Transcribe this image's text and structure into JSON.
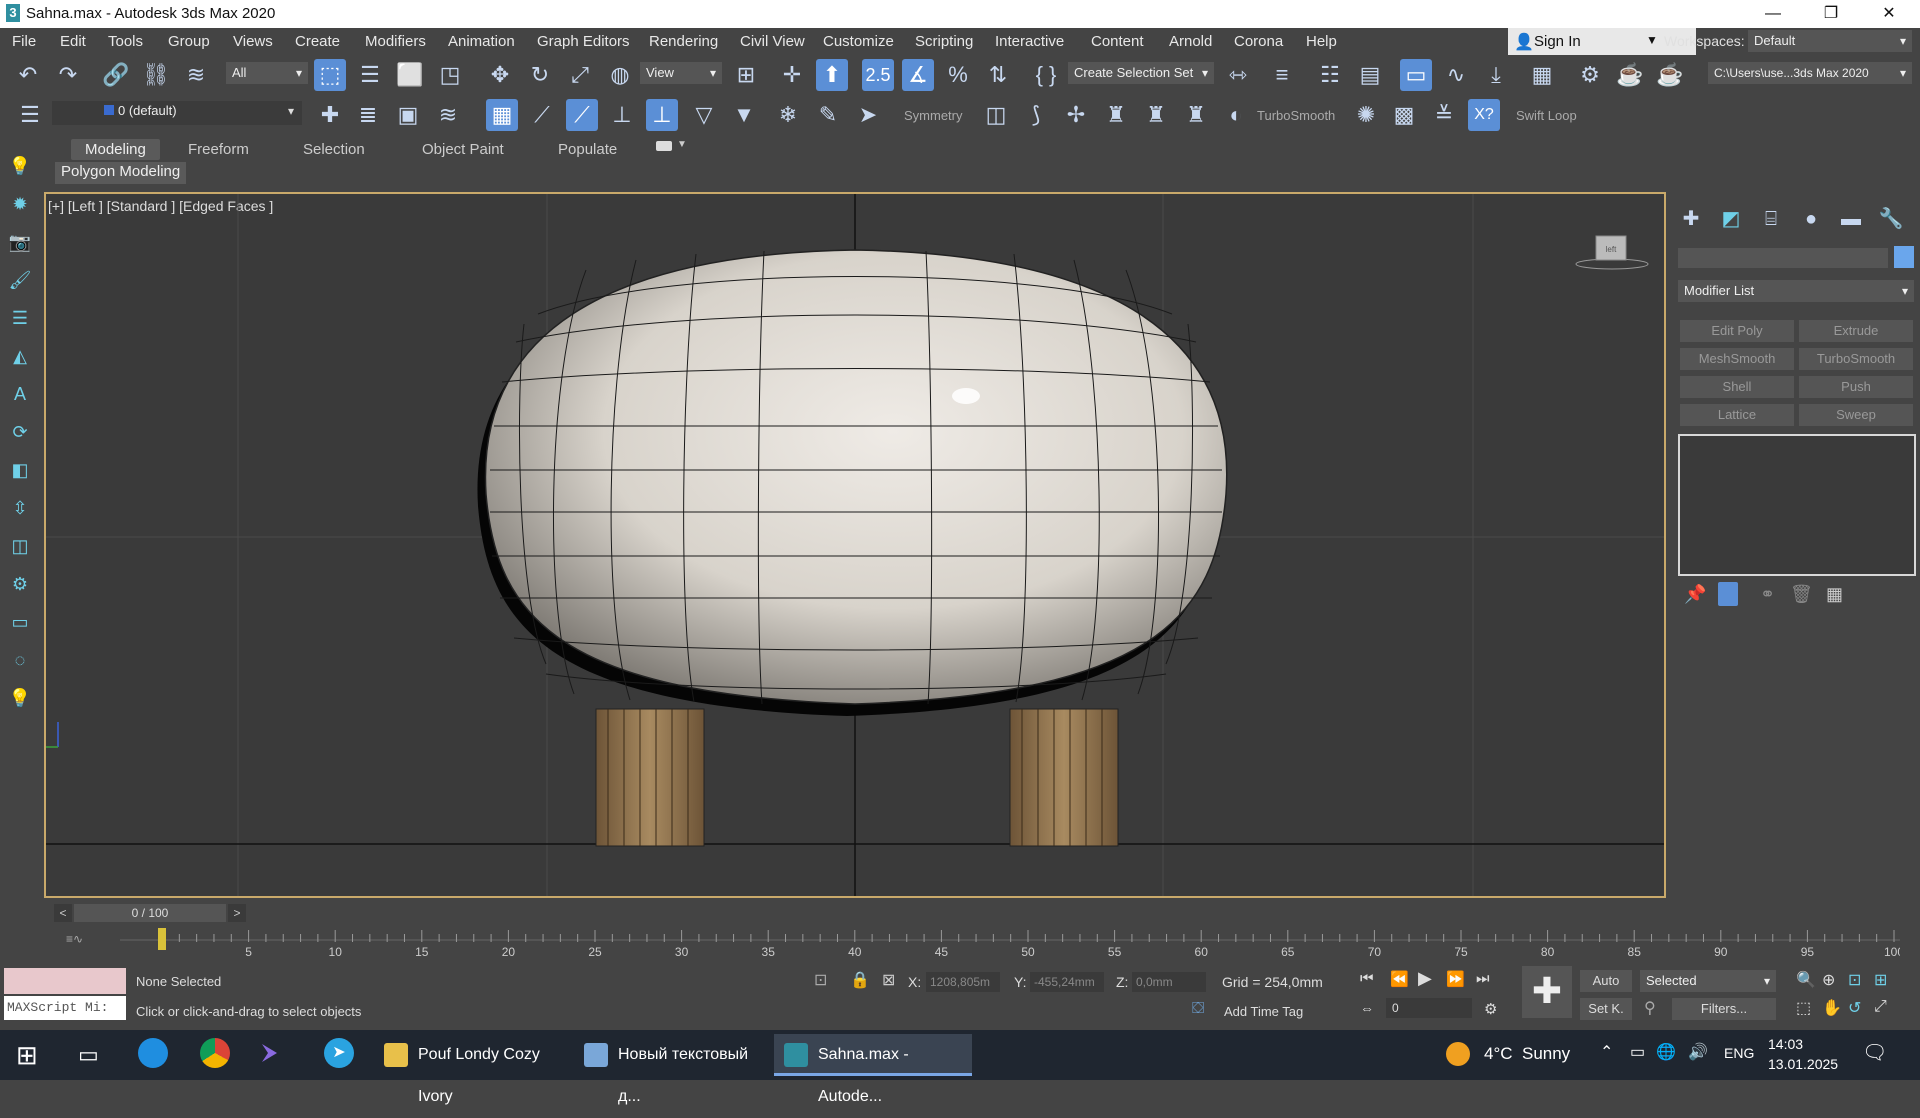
{
  "window": {
    "title": "Sahna.max - Autodesk 3ds Max 2020",
    "app_icon": "3",
    "controls": [
      "—",
      "❐",
      "✕"
    ]
  },
  "menu": [
    "File",
    "Edit",
    "Tools",
    "Group",
    "Views",
    "Create",
    "Modifiers",
    "Animation",
    "Graph Editors",
    "Rendering",
    "Civil View",
    "Customize",
    "Scripting",
    "Interactive",
    "Content",
    "Arnold",
    "Corona",
    "Help"
  ],
  "account": {
    "sign_in": "Sign In",
    "workspaces_label": "Workspaces:",
    "workspace_value": "Default"
  },
  "toolbar1": {
    "filter_value": "All",
    "refcoord_value": "View",
    "selection_set_value": "Create Selection Set",
    "path_value": "C:\\Users\\use...3ds Max 2020"
  },
  "toolbar2": {
    "layer_value": "0 (default)",
    "symmetry_label": "Symmetry",
    "turbosmooth_label": "TurboSmooth",
    "swiftloop_label": "Swift Loop"
  },
  "ribbon": {
    "tabs": [
      "Modeling",
      "Freeform",
      "Selection",
      "Object Paint",
      "Populate"
    ],
    "sub_tab": "Polygon Modeling"
  },
  "viewport": {
    "label": "[+] [Left ] [Standard ] [Edged Faces ]",
    "viewcube_face": "left"
  },
  "command_panel": {
    "modifier_list": "Modifier List",
    "buttons": [
      "Edit Poly",
      "Extrude",
      "MeshSmooth",
      "TurboSmooth",
      "Shell",
      "Push",
      "Lattice",
      "Sweep"
    ]
  },
  "timeline": {
    "frame_display": "0 / 100",
    "ticks": [
      "5",
      "10",
      "15",
      "20",
      "25",
      "30",
      "35",
      "40",
      "45",
      "50",
      "55",
      "60",
      "65",
      "70",
      "75",
      "80",
      "85",
      "90",
      "95",
      "100"
    ],
    "current_frame": 0,
    "max_frame": 100
  },
  "status": {
    "maxscript": "MAXScript Mi:",
    "selection": "None Selected",
    "prompt": "Click or click-and-drag to select objects",
    "x_label": "X:",
    "x_value": "1208,805m",
    "y_label": "Y:",
    "y_value": "-455,24mm",
    "z_label": "Z:",
    "z_value": "0,0mm",
    "grid": "Grid = 254,0mm",
    "add_time_tag": "Add Time Tag",
    "frame_value": "0",
    "auto": "Auto",
    "setk": "Set K.",
    "selected_dd": "Selected",
    "filters": "Filters..."
  },
  "taskbar": {
    "items": [
      {
        "label": "Pouf Londy Cozy Ivory",
        "icon_color": "#e8c04a"
      },
      {
        "label": "Новый текстовый д...",
        "icon_color": "#7aa7d8"
      },
      {
        "label": "Sahna.max - Autode...",
        "icon_color": "#2f8fa0"
      }
    ],
    "weather": "4°C  Sunny",
    "lang": "ENG",
    "time": "14:03",
    "date": "13.01.2025"
  },
  "colors": {
    "accent": "#5b8fd6",
    "viewport_border": "#c9a96a",
    "background": "#444444"
  }
}
